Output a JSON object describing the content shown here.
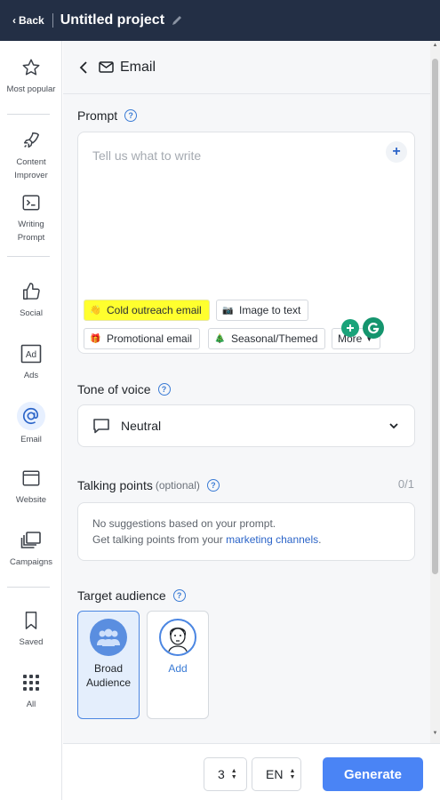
{
  "topbar": {
    "back_label": "Back",
    "project_title": "Untitled project"
  },
  "sidebar": {
    "items": [
      {
        "label": "Most popular",
        "icon": "star-icon"
      },
      {
        "label": "Content Improver",
        "icon": "rocket-icon"
      },
      {
        "label": "Writing Prompt",
        "icon": "terminal-icon"
      },
      {
        "label": "Social",
        "icon": "thumbs-up-icon"
      },
      {
        "label": "Ads",
        "icon": "ad-icon"
      },
      {
        "label": "Email",
        "icon": "at-sign-icon",
        "active": true
      },
      {
        "label": "Website",
        "icon": "browser-icon"
      },
      {
        "label": "Campaigns",
        "icon": "layers-icon"
      },
      {
        "label": "Saved",
        "icon": "bookmark-icon"
      },
      {
        "label": "All",
        "icon": "grid-icon"
      }
    ]
  },
  "header": {
    "title": "Email"
  },
  "prompt": {
    "label": "Prompt",
    "placeholder": "Tell us what to write",
    "chips": [
      {
        "label": "Cold outreach email",
        "emoji": "👋",
        "highlighted": true
      },
      {
        "label": "Image to text",
        "emoji": "📷"
      },
      {
        "label": "Promotional email",
        "emoji": "🎁"
      },
      {
        "label": "Seasonal/Themed",
        "emoji": "🎄"
      },
      {
        "label": "More",
        "emoji": ""
      }
    ]
  },
  "tone": {
    "label": "Tone of voice",
    "value": "Neutral"
  },
  "talking_points": {
    "label": "Talking points",
    "optional": "(optional)",
    "count": "0/1",
    "line1": "No suggestions based on your prompt.",
    "line2_prefix": "Get talking points from your ",
    "line2_link": "marketing channels",
    "line2_suffix": "."
  },
  "audience": {
    "label": "Target audience",
    "options": [
      {
        "label_line1": "Broad",
        "label_line2": "Audience",
        "selected": true
      },
      {
        "label_line1": "Add",
        "label_line2": "",
        "selected": false
      }
    ]
  },
  "footer": {
    "count_value": "3",
    "language": "EN",
    "generate_label": "Generate"
  },
  "colors": {
    "topbar": "#232f45",
    "accent": "#4a84f5",
    "highlight": "#ffff2e",
    "link": "#2b64c8"
  }
}
